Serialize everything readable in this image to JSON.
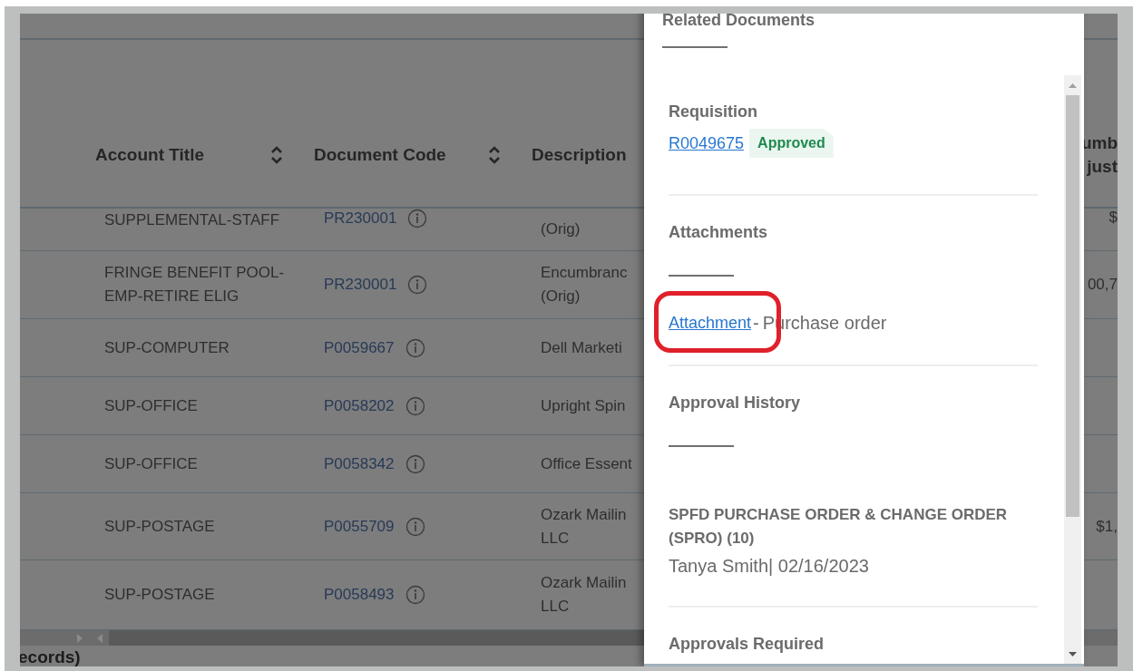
{
  "table": {
    "columns": [
      {
        "label": "Account Title",
        "sortable": true
      },
      {
        "label": "Document Code",
        "sortable": true
      },
      {
        "label": "Description"
      },
      {
        "label": "umb\njust"
      }
    ],
    "rows": [
      {
        "account": "SUPPLEMENTAL-STAFF",
        "document_code": "PR230001",
        "description": "(Orig)",
        "column_4": "$"
      },
      {
        "account": "FRINGE BENEFIT POOL-\nEMP-RETIRE ELIG",
        "document_code": "PR230001",
        "description": "Encumbranc\n(Orig)",
        "column_4": "00,7"
      },
      {
        "account": "SUP-COMPUTER",
        "document_code": "P0059667",
        "description": "Dell Marketi"
      },
      {
        "account": "SUP-OFFICE",
        "document_code": "P0058202",
        "description": "Upright Spin"
      },
      {
        "account": "SUP-OFFICE",
        "document_code": "P0058342",
        "description": "Office Essent"
      },
      {
        "account": "SUP-POSTAGE",
        "document_code": "P0055709",
        "description": "Ozark Mailin\nLLC",
        "column_4": "$1,"
      },
      {
        "account": "SUP-POSTAGE",
        "document_code": "P0058493",
        "description": "Ozark Mailin\nLLC"
      }
    ],
    "footer": "ecords)"
  },
  "panel": {
    "title": "Related Documents",
    "sections": [
      {
        "kind": "requisition",
        "heading": "Requisition",
        "link": "R0049675",
        "badge": "Approved"
      },
      {
        "kind": "attachments",
        "heading": "Attachments",
        "link": "Attachment ",
        "separator": "-",
        "text": "Purchase order",
        "highlighted": true
      },
      {
        "kind": "history",
        "heading": "Approval History",
        "step": "SPFD PURCHASE ORDER & CHANGE ORDER (SPRO) (10)",
        "approver": "Tanya Smith| 02/16/2023"
      },
      {
        "kind": "heading",
        "heading": "Approvals Required"
      }
    ]
  }
}
